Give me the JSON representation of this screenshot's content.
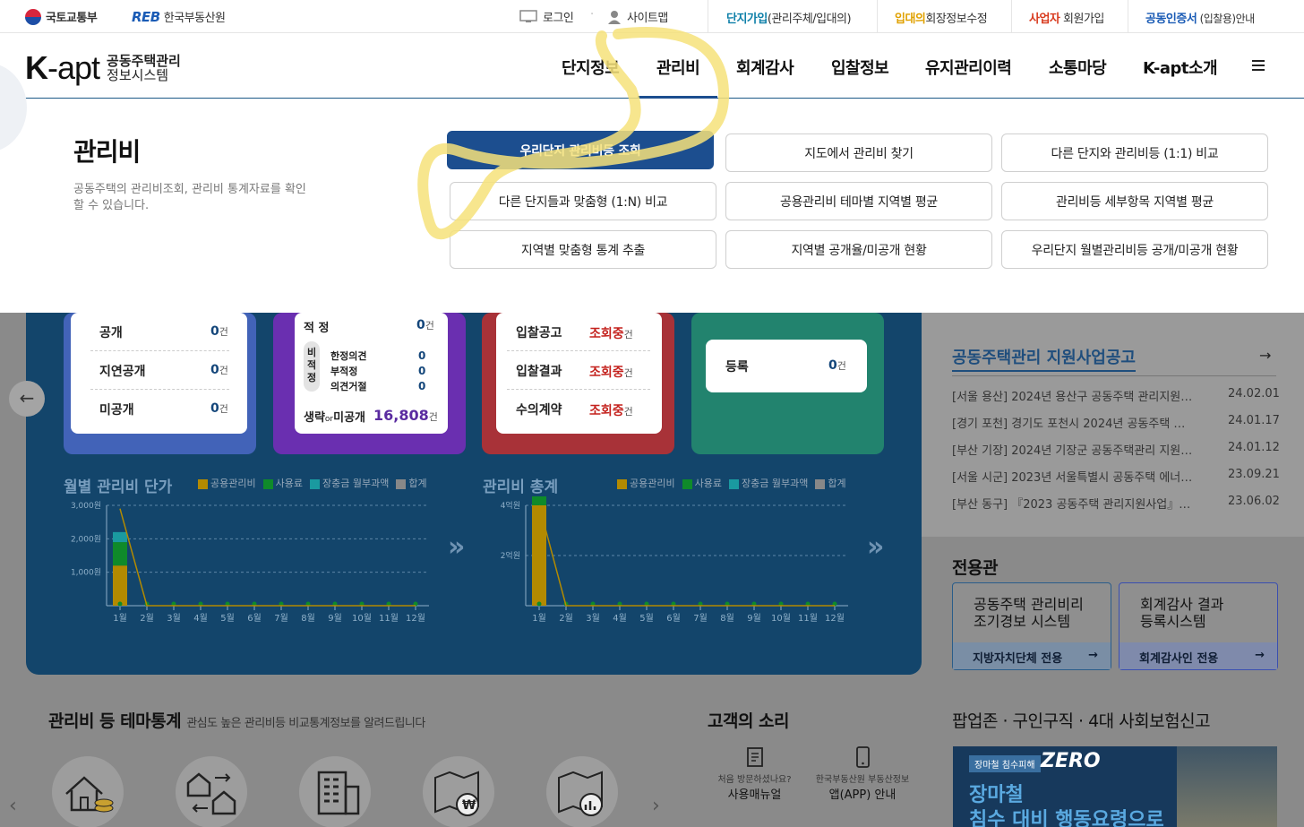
{
  "topbar": {
    "molit": "국토교통부",
    "reb_mark": "REB",
    "reb_name": "한국부동산원",
    "login": "로그인",
    "sitemap": "사이트맵",
    "join_key": "단지가입",
    "join_rest": "(관리주체/입대의)",
    "rep_key": "입대의",
    "rep_rest": "회장정보수정",
    "biz_key": "사업자",
    "biz_rest": " 회원가입",
    "cert_key": "공동인증서",
    "cert_rest": " (입찰용)안내"
  },
  "brand": {
    "logo_a": "K",
    "logo_b": "-apt",
    "line1": "공동주택관리",
    "line2": "정보시스템"
  },
  "nav": [
    "단지정보",
    "관리비",
    "회계감사",
    "입찰정보",
    "유지관리이력",
    "소통마당",
    "K-apt소개"
  ],
  "menu_icon": "hamburger-icon",
  "mega": {
    "title": "관리비",
    "desc": "공동주택의 관리비조회, 관리비 통계자료를 확인 할 수 있습니다.",
    "buttons": [
      "우리단지 관리비등 조회",
      "지도에서 관리비 찾기",
      "다른 단지와 관리비등 (1:1) 비교",
      "다른 단지들과 맞춤형 (1:N) 비교",
      "공용관리비 테마별 지역별 평균",
      "관리비등 세부항목 지역별 평균",
      "지역별 맞춤형 통계 추출",
      "지역별 공개율/미공개 현황",
      "우리단지 월별관리비등 공개/미공개 현황"
    ]
  },
  "dashboard": {
    "card1": [
      {
        "label": "공개",
        "value": "0",
        "unit": "건"
      },
      {
        "label": "지연공개",
        "value": "0",
        "unit": "건"
      },
      {
        "label": "미공개",
        "value": "0",
        "unit": "건"
      }
    ],
    "card2": {
      "top_label": "적 정",
      "top_value": "0",
      "unit": "건",
      "side_label": "비적정",
      "sub": [
        {
          "label": "한정의견",
          "value": "0"
        },
        {
          "label": "부적정",
          "value": "0"
        },
        {
          "label": "의견거절",
          "value": "0"
        }
      ],
      "bottom_label_a": "생략",
      "bottom_label_or": "or",
      "bottom_label_b": "미공개",
      "bottom_value": "16,808"
    },
    "card3": [
      {
        "label": "입찰공고",
        "value": "조회중",
        "unit": "건"
      },
      {
        "label": "입찰결과",
        "value": "조회중",
        "unit": "건"
      },
      {
        "label": "수의계약",
        "value": "조회중",
        "unit": "건"
      }
    ],
    "card4": {
      "label": "등록",
      "value": "0",
      "unit": "건"
    }
  },
  "legend": [
    "공용관리비",
    "사용료",
    "장충금 월부과액",
    "합계"
  ],
  "legend_colors": [
    "#b38a00",
    "#0f8a2a",
    "#1a9aa0",
    "#888888"
  ],
  "chart_data": [
    {
      "type": "bar",
      "title": "월별 관리비 단가",
      "categories": [
        "1월",
        "2월",
        "3월",
        "4월",
        "5월",
        "6월",
        "7월",
        "8월",
        "9월",
        "10월",
        "11월",
        "12월"
      ],
      "y_ticks": [
        "3,000원",
        "2,000원",
        "1,000원"
      ],
      "ylim": [
        0,
        3000
      ],
      "series": [
        {
          "name": "공용관리비",
          "values": [
            1200,
            0,
            0,
            0,
            0,
            0,
            0,
            0,
            0,
            0,
            0,
            0
          ]
        },
        {
          "name": "사용료",
          "values": [
            700,
            0,
            0,
            0,
            0,
            0,
            0,
            0,
            0,
            0,
            0,
            0
          ]
        },
        {
          "name": "장충금 월부과액",
          "values": [
            300,
            0,
            0,
            0,
            0,
            0,
            0,
            0,
            0,
            0,
            0,
            0
          ]
        },
        {
          "name": "합계",
          "values": [
            2900,
            0,
            0,
            0,
            0,
            0,
            0,
            0,
            0,
            0,
            0,
            0
          ]
        }
      ]
    },
    {
      "type": "bar",
      "title": "관리비 총계",
      "categories": [
        "1월",
        "2월",
        "3월",
        "4월",
        "5월",
        "6월",
        "7월",
        "8월",
        "9월",
        "10월",
        "11월",
        "12월"
      ],
      "y_ticks": [
        "4억원",
        "2억원"
      ],
      "ylim": [
        0,
        400000000
      ],
      "series": [
        {
          "name": "공용관리비",
          "values": [
            1800000000,
            0,
            0,
            0,
            0,
            0,
            0,
            0,
            0,
            0,
            0,
            0
          ]
        },
        {
          "name": "사용료",
          "values": [
            100000000,
            0,
            0,
            0,
            0,
            0,
            0,
            0,
            0,
            0,
            0,
            0
          ]
        },
        {
          "name": "장충금 월부과액",
          "values": [
            50000000,
            0,
            0,
            0,
            0,
            0,
            0,
            0,
            0,
            0,
            0,
            0
          ]
        },
        {
          "name": "합계",
          "values": [
            400000000,
            0,
            0,
            0,
            0,
            0,
            0,
            0,
            0,
            0,
            0,
            0
          ]
        }
      ]
    }
  ],
  "support": {
    "title": "공동주택관리 지원사업공고",
    "items": [
      {
        "text": "[서울 용산] 2024년 용산구 공동주택 관리지원 …",
        "date": "24.02.01"
      },
      {
        "text": "[경기 포천] 경기도 포천시 2024년 공동주택 지…",
        "date": "24.01.17"
      },
      {
        "text": "[부산 기장] 2024년 기장군 공동주택관리 지원…",
        "date": "24.01.12"
      },
      {
        "text": "[서울 시군] 2023년 서울특별시 공동주택 에너…",
        "date": "23.09.21"
      },
      {
        "text": "[부산 동구] 『2023 공동주택 관리지원사업』 …",
        "date": "23.06.02"
      }
    ]
  },
  "exclusive": {
    "title": "전용관",
    "boxes": [
      {
        "line1": "공동주택 관리비리",
        "line2": "조기경보 시스템",
        "foot": "지방자치단체 전용"
      },
      {
        "line1": "회계감사 결과",
        "line2": "등록시스템",
        "foot": "회계감사인 전용"
      }
    ]
  },
  "theme": {
    "title": "관리비 등 테마통계",
    "sub": "관심도 높은 관리비등 비교통계정보를 알려드립니다"
  },
  "voice": {
    "title": "고객의 소리",
    "items": [
      {
        "small": "처음 방문하셨나요?",
        "big": "사용매뉴얼"
      },
      {
        "small": "한국부동산원 부동산정보",
        "big": "앱(APP) 안내"
      }
    ]
  },
  "popupzone": {
    "title": "팝업존 · 구인구직 · 4대 사회보험신고",
    "badge": "장마철 침수피해",
    "zero": "ZERO",
    "line1": "장마철",
    "line2": "침수 대비 행동요령으로"
  }
}
